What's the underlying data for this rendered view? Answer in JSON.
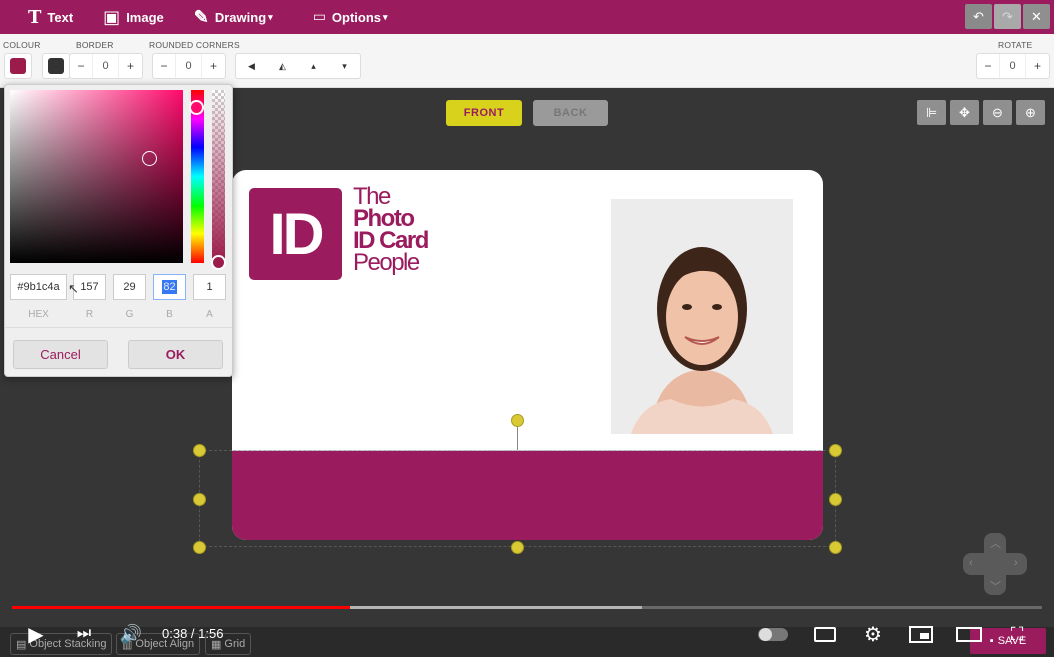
{
  "toolbar": {
    "text_label": "Text",
    "image_label": "Image",
    "drawing_label": "Drawing",
    "options_label": "Options",
    "undo_icon": "↶",
    "redo_icon": "↷",
    "close_icon": "✕"
  },
  "properties": {
    "colour_label": "COLOUR",
    "border_label": "BORDER",
    "rounded_label": "ROUNDED CORNERS",
    "rotate_label": "ROTATE",
    "border_value": "0",
    "rounded_value": "0",
    "rotate_value": "0",
    "fill_color": "#9b1c4a",
    "border_color": "#333333"
  },
  "canvas": {
    "front_label": "FRONT",
    "back_label": "BACK"
  },
  "card": {
    "logo_initials": "ID",
    "logo_line1": "The",
    "logo_line2": "Photo",
    "logo_line3": "ID Card",
    "logo_line4": "People",
    "accent_color": "#9b1c5e"
  },
  "picker": {
    "hex": "#9b1c4a",
    "r": "157",
    "g": "29",
    "b": "82",
    "a": "1",
    "hex_label": "HEX",
    "r_label": "R",
    "g_label": "G",
    "b_label": "B",
    "a_label": "A",
    "cancel_label": "Cancel",
    "ok_label": "OK"
  },
  "bottom": {
    "stacking_label": "Object Stacking",
    "align_label": "Object Align",
    "grid_label": "Grid",
    "save_label": "SAVE"
  },
  "video": {
    "time": "0:38 / 1:56",
    "progress_fraction": 0.328,
    "buffered_fraction": 0.612
  }
}
